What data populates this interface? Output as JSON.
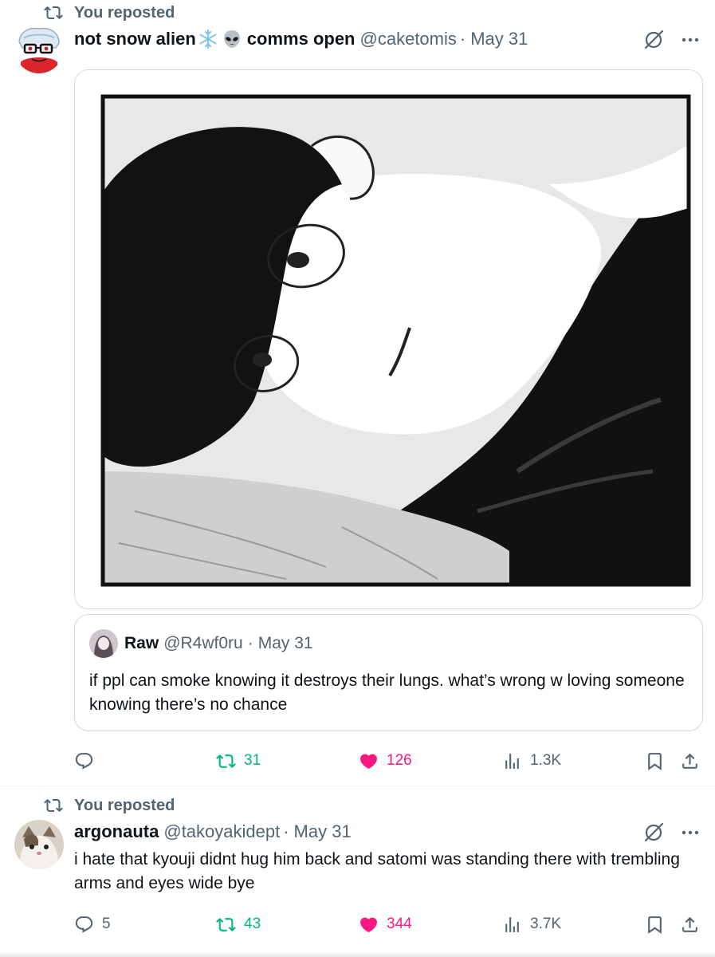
{
  "colors": {
    "repost_green": "#00ba7c",
    "like_pink": "#f91880",
    "muted": "#536471",
    "text": "#0f1419",
    "border": "#cfd9de"
  },
  "posts": [
    {
      "repost_label": "You reposted",
      "author": {
        "name_start": "not snow alien",
        "name_end": "comms open",
        "handle": "@caketomis",
        "separator": "·",
        "date": "May 31"
      },
      "emoji": [
        "snowflake-emoji",
        "alien-emoji"
      ],
      "media": {
        "kind": "manga-panel-illustration"
      },
      "quote": {
        "author": {
          "name": "Raw",
          "handle": "@R4wf0ru",
          "separator": "·",
          "date": "May 31"
        },
        "text": "if ppl can smoke knowing it destroys their lungs. what’s wrong w loving someone knowing there’s no chance"
      },
      "actions": {
        "replies": "",
        "reposts": "31",
        "likes": "126",
        "views": "1.3K"
      }
    },
    {
      "repost_label": "You reposted",
      "author": {
        "name": "argonauta",
        "handle": "@takoyakidept",
        "separator": "·",
        "date": "May 31"
      },
      "text": "i hate that kyouji didnt hug him back and satomi was standing there with trembling arms and eyes wide bye",
      "actions": {
        "replies": "5",
        "reposts": "43",
        "likes": "344",
        "views": "3.7K"
      }
    }
  ]
}
